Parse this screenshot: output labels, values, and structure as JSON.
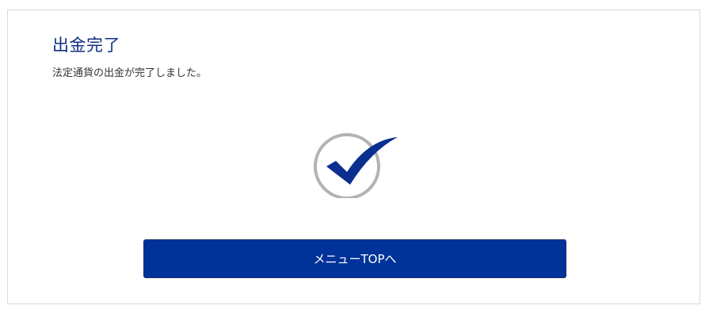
{
  "page": {
    "title": "出金完了",
    "message": "法定通貨の出金が完了しました。"
  },
  "status_icon": {
    "name": "success-check-icon",
    "ring_color": "#b3b3b3",
    "check_color": "#0a2f8f"
  },
  "actions": {
    "menu_top_label": "メニューTOPへ",
    "button_color": "#003399"
  }
}
